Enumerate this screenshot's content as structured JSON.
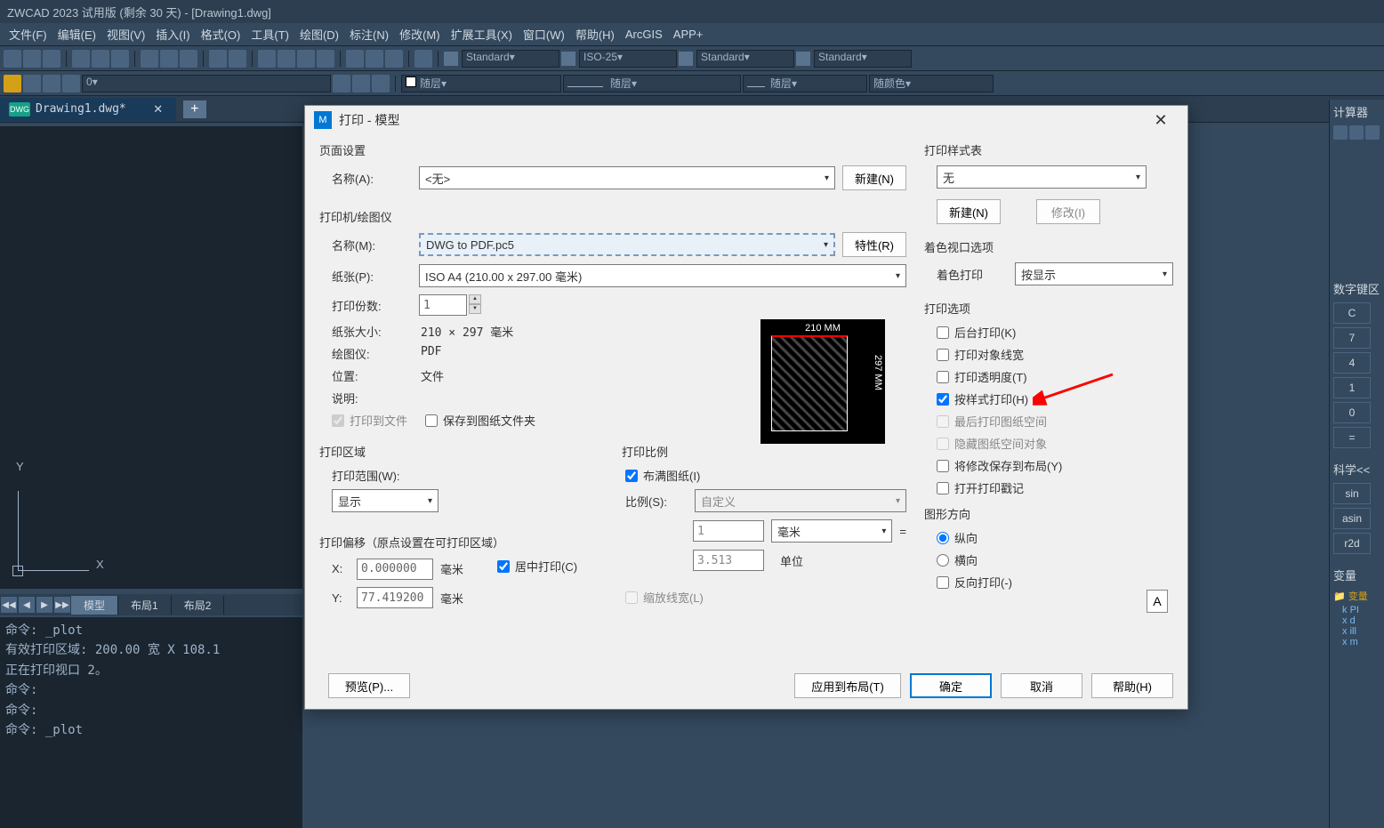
{
  "app_title": "ZWCAD 2023 试用版 (剩余 30 天) - [Drawing1.dwg]",
  "menu": [
    "文件(F)",
    "编辑(E)",
    "视图(V)",
    "插入(I)",
    "格式(O)",
    "工具(T)",
    "绘图(D)",
    "标注(N)",
    "修改(M)",
    "扩展工具(X)",
    "窗口(W)",
    "帮助(H)",
    "ArcGIS",
    "APP+"
  ],
  "toolbar": {
    "style1": "Standard",
    "style2": "ISO-25",
    "style3": "Standard",
    "style4": "Standard",
    "layer0": "0",
    "combo_layer1": "随层",
    "combo_layer2": "随层",
    "combo_layer3": "随层",
    "combo_color": "随颜色"
  },
  "doc_tab": {
    "icon_text": "DWG",
    "name": "Drawing1.dwg*"
  },
  "layout_tabs": {
    "model": "模型",
    "layout1": "布局1",
    "layout2": "布局2"
  },
  "cmd_lines": "命令: _plot\n有效打印区域: 200.00 宽 X 108.1\n正在打印视口 2。\n命令:\n命令:\n命令: _plot",
  "right_panel": {
    "calc_title": "计算器",
    "numpad_title": "数字键区",
    "keys": [
      "C",
      "7",
      "4",
      "1",
      "0",
      "="
    ],
    "sci_title": "科学<<",
    "sci_keys": [
      "sin",
      "asin",
      "r2d"
    ],
    "var_title": "变量",
    "var_items": [
      "变量",
      "PI",
      "d",
      "ill",
      "m"
    ]
  },
  "dialog": {
    "title": "打印 - 模型",
    "page_setup": {
      "group": "页面设置",
      "name_label": "名称(A):",
      "name_value": "<无>",
      "new_btn": "新建(N)"
    },
    "printer": {
      "group": "打印机/绘图仪",
      "name_label": "名称(M):",
      "name_value": "DWG to PDF.pc5",
      "prop_btn": "特性(R)",
      "paper_label": "纸张(P):",
      "paper_value": "ISO A4 (210.00 x 297.00 毫米)",
      "copies_label": "打印份数:",
      "copies_value": "1",
      "size_label": "纸张大小:",
      "size_value": "210 × 297  毫米",
      "plotter_label": "绘图仪:",
      "plotter_value": "PDF",
      "location_label": "位置:",
      "location_value": "文件",
      "desc_label": "说明:",
      "print_to_file": "打印到文件",
      "save_to_sheet": "保存到图纸文件夹"
    },
    "area": {
      "group": "打印区域",
      "range_label": "打印范围(W):",
      "range_value": "显示"
    },
    "offset": {
      "group": "打印偏移（原点设置在可打印区域）",
      "x_label": "X:",
      "x_value": "0.000000",
      "x_unit": "毫米",
      "y_label": "Y:",
      "y_value": "77.419200",
      "y_unit": "毫米",
      "center": "居中打印(C)"
    },
    "scale": {
      "group": "打印比例",
      "fit": "布满图纸(I)",
      "scale_label": "比例(S):",
      "scale_value": "自定义",
      "num": "1",
      "num_unit": "毫米",
      "equals": "=",
      "den": "3.513",
      "den_unit": "单位",
      "lw": "缩放线宽(L)"
    },
    "style": {
      "group": "打印样式表",
      "value": "无",
      "new_btn": "新建(N)",
      "mod_btn": "修改(I)"
    },
    "shade": {
      "group": "着色视口选项",
      "label": "着色打印",
      "value": "按显示"
    },
    "options": {
      "group": "打印选项",
      "bg": "后台打印(K)",
      "lw": "打印对象线宽",
      "trans": "打印透明度(T)",
      "bystyle": "按样式打印(H)",
      "last_paper": "最后打印图纸空间",
      "hide_paper": "隐藏图纸空间对象",
      "save_layout": "将修改保存到布局(Y)",
      "stamp": "打开打印戳记"
    },
    "orient": {
      "group": "图形方向",
      "portrait": "纵向",
      "landscape": "横向",
      "reverse": "反向打印(-)",
      "glyph": "A"
    },
    "preview_top": "210 MM",
    "preview_right": "297 MM",
    "footer": {
      "preview": "预览(P)...",
      "apply": "应用到布局(T)",
      "ok": "确定",
      "cancel": "取消",
      "help": "帮助(H)"
    }
  }
}
